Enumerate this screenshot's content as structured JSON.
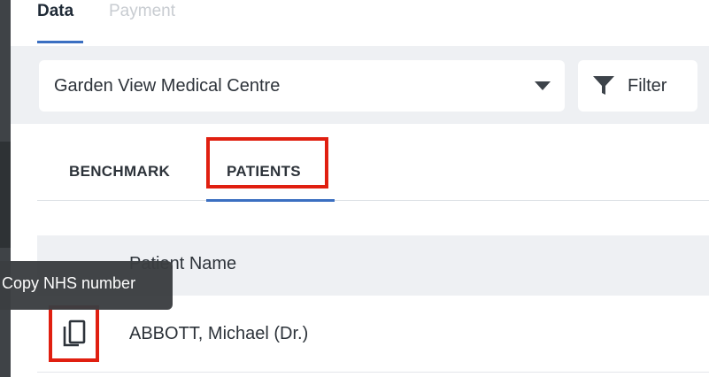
{
  "top_tabs": [
    {
      "label": "Data",
      "active": true
    },
    {
      "label": "Payment",
      "active": false
    }
  ],
  "practice_select": {
    "value": "Garden View Medical Centre"
  },
  "filter_button": {
    "label": "Filter"
  },
  "inner_tabs": [
    {
      "label": "BENCHMARK",
      "active": false
    },
    {
      "label": "PATIENTS",
      "active": true
    }
  ],
  "table": {
    "columns": [
      "Patient Name"
    ],
    "rows": [
      {
        "name": "ABBOTT, Michael (Dr.)"
      }
    ]
  },
  "tooltip": {
    "text": "Copy NHS number"
  },
  "icons": [
    "caret-down-icon",
    "filter-icon",
    "copy-icon"
  ],
  "colors": {
    "accent": "#3b6fc1",
    "highlight": "#e01f10",
    "band": "#eef0f3",
    "tooltip_bg": "#3b3e41"
  }
}
